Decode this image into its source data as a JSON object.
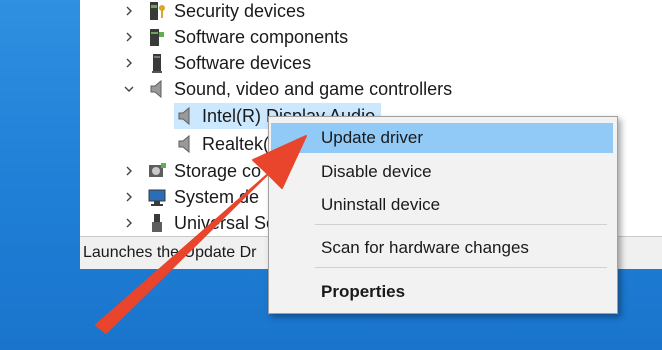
{
  "tree": {
    "items": [
      {
        "label": "Security devices",
        "icon": "key-chip-icon",
        "chevron": "right"
      },
      {
        "label": "Software components",
        "icon": "puzzle-chip-icon",
        "chevron": "right"
      },
      {
        "label": "Software devices",
        "icon": "device-tower-icon",
        "chevron": "right"
      },
      {
        "label": "Sound, video and game controllers",
        "icon": "speaker-icon",
        "chevron": "down"
      },
      {
        "label": "Intel(R) Display Audio",
        "icon": "speaker-icon"
      },
      {
        "label": "Realtek(",
        "icon": "speaker-icon"
      },
      {
        "label": "Storage co",
        "icon": "storage-icon",
        "chevron": "right"
      },
      {
        "label": "System de",
        "icon": "system-monitor-icon",
        "chevron": "right"
      },
      {
        "label": "Universal Se",
        "icon": "usb-icon",
        "chevron": "right"
      }
    ]
  },
  "statusbar": {
    "text": "Launches the Update Dr"
  },
  "context_menu": {
    "items": [
      {
        "label": "Update driver",
        "highlighted": true
      },
      {
        "label": "Disable device"
      },
      {
        "label": "Uninstall device"
      },
      {
        "label": "Scan for hardware changes"
      },
      {
        "label": "Properties",
        "bold": true
      }
    ]
  },
  "colors": {
    "desktop": "#1f7fd6",
    "selection": "#cce8ff",
    "menu_highlight": "#91c9f7",
    "annotation_arrow": "#e8452c"
  }
}
